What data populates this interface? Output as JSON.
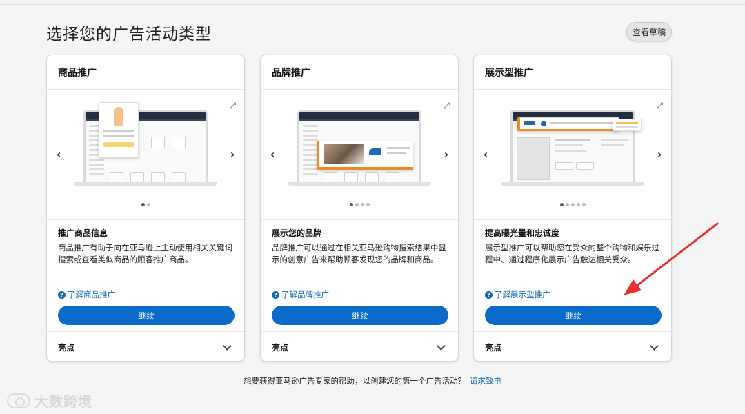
{
  "page": {
    "title": "选择您的广告活动类型",
    "draft_button": "查看草稿"
  },
  "cards": [
    {
      "header": "商品推广",
      "section_title": "推广商品信息",
      "section_desc": "商品推广有助于向在亚马逊上主动使用相关关键词搜索或查看类似商品的顾客推广商品。",
      "learn_more": "了解商品推广",
      "cta": "继续",
      "footer": "亮点",
      "dots": 2,
      "active_dot": 0
    },
    {
      "header": "品牌推广",
      "section_title": "展示您的品牌",
      "section_desc": "品牌推广可以通过在相关亚马逊购物搜索结果中显示的创意广告来帮助顾客发现您的品牌和商品。",
      "learn_more": "了解品牌推广",
      "cta": "继续",
      "footer": "亮点",
      "dots": 4,
      "active_dot": 0
    },
    {
      "header": "展示型推广",
      "section_title": "提高曝光量和忠诚度",
      "section_desc": "展示型推广可以帮助您在受众的整个购物和娱乐过程中、通过程序化展示广告触达相关受众。",
      "learn_more": "了解展示型推广",
      "cta": "继续",
      "footer": "亮点",
      "dots": 5,
      "active_dot": 0
    }
  ],
  "help": {
    "text": "想要获得亚马逊广告专家的帮助，以创建您的第一个广告活动？",
    "link": "请求致电"
  },
  "watermark": {
    "text": "大数跨境"
  },
  "colors": {
    "primary_button": "#0b6bcb",
    "link": "#0f6ab4",
    "annotation_arrow": "#e8312f"
  },
  "icons": {
    "carousel_prev": "chevron-left-icon",
    "carousel_next": "chevron-right-icon",
    "expand": "expand-icon",
    "help": "question-circle-icon",
    "footer_toggle": "chevron-down-icon"
  }
}
